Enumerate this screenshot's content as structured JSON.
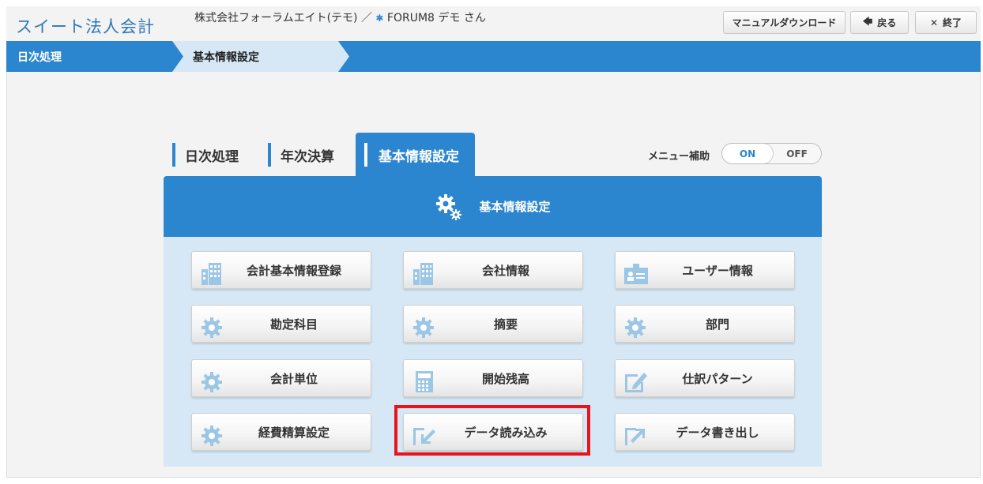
{
  "header": {
    "app_title": "スイート法人会計",
    "user_line_prefix": "株式会社フォーラムエイト(テモ) ／ ",
    "user_line_name": "FORUM8 デモ さん",
    "buttons": {
      "manual": "マニュアルダウンロード",
      "back": "戻る",
      "quit": "終了"
    }
  },
  "breadcrumb": {
    "items": [
      "日次処理",
      "基本情報設定"
    ]
  },
  "tabs": [
    {
      "label": "日次処理",
      "active": false
    },
    {
      "label": "年次決算",
      "active": false
    },
    {
      "label": "基本情報設定",
      "active": true
    }
  ],
  "menu_help": {
    "label": "メニュー補助",
    "on": "ON",
    "off": "OFF",
    "selected": "ON"
  },
  "panel": {
    "title": "基本情報設定",
    "buttons": [
      {
        "label": "会計基本情報登録",
        "icon": "building-icon"
      },
      {
        "label": "会社情報",
        "icon": "building-icon"
      },
      {
        "label": "ユーザー情報",
        "icon": "id-card-icon"
      },
      {
        "label": "勘定科目",
        "icon": "gear-icon"
      },
      {
        "label": "摘要",
        "icon": "gear-icon"
      },
      {
        "label": "部門",
        "icon": "gear-icon"
      },
      {
        "label": "会計単位",
        "icon": "gear-icon"
      },
      {
        "label": "開始残高",
        "icon": "calculator-icon"
      },
      {
        "label": "仕訳パターン",
        "icon": "pencil-icon"
      },
      {
        "label": "経費精算設定",
        "icon": "gear-icon"
      },
      {
        "label": "データ読み込み",
        "icon": "import-icon"
      },
      {
        "label": "データ書き出し",
        "icon": "export-icon"
      }
    ]
  },
  "colors": {
    "accent": "#2b86cf",
    "panel_bg": "#d6e8f5",
    "icon": "#9cc6e6",
    "highlight": "#e8141b"
  }
}
